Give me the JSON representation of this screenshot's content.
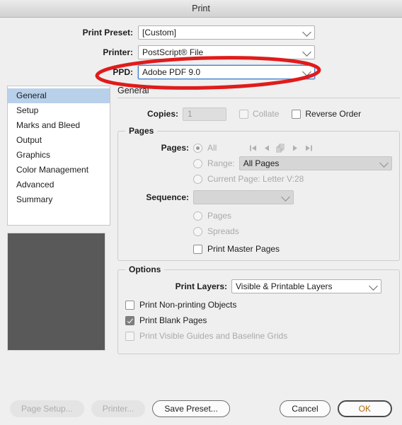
{
  "window": {
    "title": "Print"
  },
  "top_fields": [
    {
      "label": "Print Preset:",
      "value": "[Custom]"
    },
    {
      "label": "Printer:",
      "value": "PostScript® File"
    },
    {
      "label": "PPD:",
      "value": "Adobe PDF 9.0"
    }
  ],
  "sidebar": {
    "items": [
      {
        "label": "General"
      },
      {
        "label": "Setup"
      },
      {
        "label": "Marks and Bleed"
      },
      {
        "label": "Output"
      },
      {
        "label": "Graphics"
      },
      {
        "label": "Color Management"
      },
      {
        "label": "Advanced"
      },
      {
        "label": "Summary"
      }
    ],
    "selected_index": 0
  },
  "panel": {
    "title": "General",
    "copies": {
      "label": "Copies:",
      "value": "1"
    },
    "collate": {
      "label": "Collate",
      "checked": false
    },
    "reverse_order": {
      "label": "Reverse Order",
      "checked": false
    },
    "pages_group": {
      "title": "Pages",
      "pages_label": "Pages:",
      "all": {
        "label": "All",
        "selected": true
      },
      "range": {
        "label": "Range:",
        "value": "All Pages"
      },
      "current_page": {
        "label": "Current Page: Letter V:28"
      },
      "sequence": {
        "label": "Sequence:",
        "value": ""
      },
      "pages_radio": {
        "label": "Pages"
      },
      "spreads_radio": {
        "label": "Spreads"
      },
      "print_master_pages": {
        "label": "Print Master Pages",
        "checked": false
      },
      "nav_icons": [
        "first-page-icon",
        "previous-page-icon",
        "spread-preview-icon",
        "next-page-icon",
        "last-page-icon"
      ]
    },
    "options_group": {
      "title": "Options",
      "print_layers": {
        "label": "Print Layers:",
        "value": "Visible & Printable Layers"
      },
      "print_non_printing": {
        "label": "Print Non-printing Objects",
        "checked": false
      },
      "print_blank_pages": {
        "label": "Print Blank Pages",
        "checked": true
      },
      "print_visible_guides": {
        "label": "Print Visible Guides and Baseline Grids",
        "checked": false
      }
    }
  },
  "footer": {
    "page_setup": "Page Setup...",
    "printer": "Printer...",
    "save_preset": "Save Preset...",
    "cancel": "Cancel",
    "ok": "OK"
  },
  "annotation": {
    "color": "#e01b1b",
    "shape": "ellipse",
    "target": "PPD field"
  },
  "colors": {
    "selection": "#b8d0ea",
    "focus_ring": "#3f7fd0",
    "annotation_red": "#e01b1b",
    "preview_fill": "#595959",
    "window_bg": "#efefef"
  }
}
